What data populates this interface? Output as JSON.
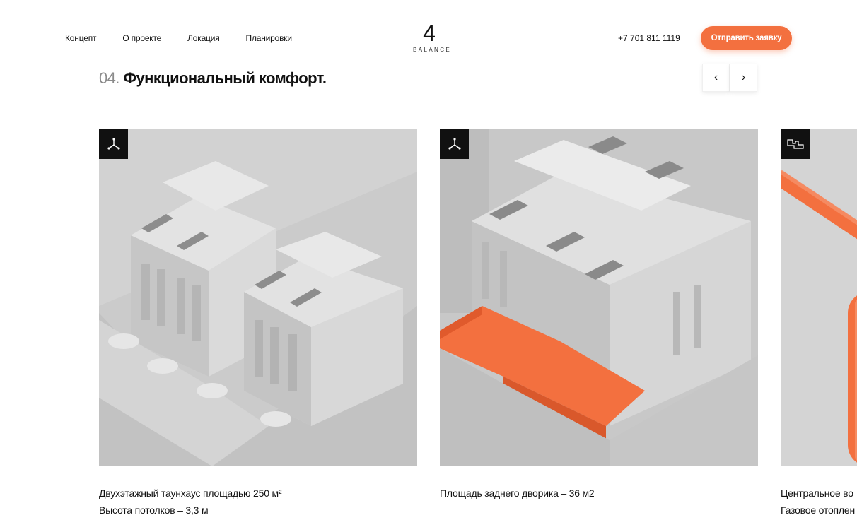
{
  "header": {
    "nav": [
      "Концепт",
      "О проекте",
      "Локация",
      "Планировки"
    ],
    "logo_number": "4",
    "logo_word": "BALANCE",
    "phone": "+7 701 811 1119",
    "cta_label": "Отправить заявку"
  },
  "section": {
    "number": "04.",
    "title": "Функциональный комфорт.",
    "prev_icon": "‹",
    "next_icon": "›"
  },
  "cards": [
    {
      "icon": "axis-3d-icon",
      "lines": [
        "Двухэтажный таунхаус площадью 250 м²",
        "Высота потолков – 3,3 м"
      ]
    },
    {
      "icon": "axis-3d-icon",
      "lines": [
        "Площадь заднего дворика – 36 м2"
      ]
    },
    {
      "icon": "floorplan-icon",
      "lines": [
        "Центральное во",
        "Газовое отоплен"
      ]
    }
  ],
  "colors": {
    "accent": "#f3703f",
    "badge": "#111111",
    "render_gray": "#cfcfcf"
  }
}
